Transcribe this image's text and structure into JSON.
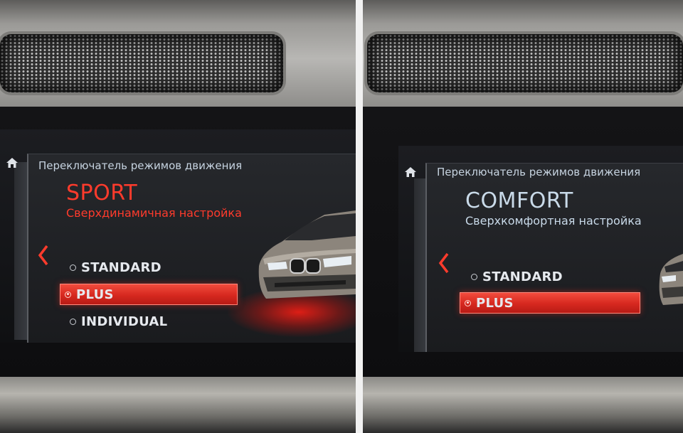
{
  "panels": [
    {
      "header_title": "Переключатель режимов движения",
      "mode_name": "SPORT",
      "mode_description": "Сверхдинамичная настройка",
      "mode_color": "#ff3b2c",
      "options": [
        {
          "label": "STANDARD",
          "selected": false
        },
        {
          "label": "PLUS",
          "selected": true
        },
        {
          "label": "INDIVIDUAL",
          "selected": false
        }
      ]
    },
    {
      "header_title": "Переключатель режимов движения",
      "mode_name": "COMFORT",
      "mode_description": "Сверхкомфортная настройка",
      "mode_color": "#c9dae9",
      "options": [
        {
          "label": "STANDARD",
          "selected": false
        },
        {
          "label": "PLUS",
          "selected": true
        }
      ]
    }
  ],
  "icons": {
    "home": "home-icon",
    "back": "chevron-left-icon"
  },
  "colors": {
    "accent_red": "#e02a20",
    "header_text": "#c6d3e0"
  }
}
